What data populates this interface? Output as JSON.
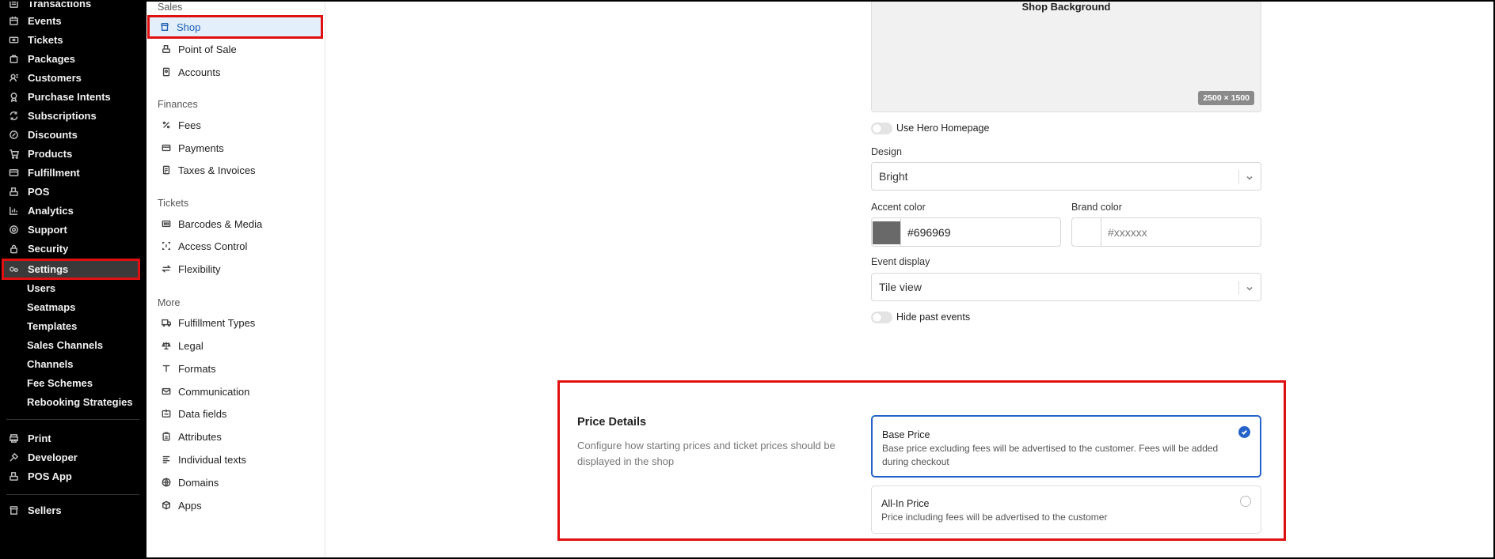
{
  "left_nav": {
    "items": [
      {
        "label": "Transactions",
        "icon": "receipt-icon"
      },
      {
        "label": "Events",
        "icon": "calendar-icon"
      },
      {
        "label": "Tickets",
        "icon": "ticket-icon"
      },
      {
        "label": "Packages",
        "icon": "package-icon"
      },
      {
        "label": "Customers",
        "icon": "customers-icon"
      },
      {
        "label": "Purchase Intents",
        "icon": "intent-icon"
      },
      {
        "label": "Subscriptions",
        "icon": "refresh-icon"
      },
      {
        "label": "Discounts",
        "icon": "discount-icon"
      },
      {
        "label": "Products",
        "icon": "cart-icon"
      },
      {
        "label": "Fulfillment",
        "icon": "truck-icon"
      },
      {
        "label": "POS",
        "icon": "register-icon"
      },
      {
        "label": "Analytics",
        "icon": "chart-icon"
      },
      {
        "label": "Support",
        "icon": "support-icon"
      },
      {
        "label": "Security",
        "icon": "lock-icon"
      },
      {
        "label": "Settings",
        "icon": "settings-icon"
      }
    ],
    "settings_sub": [
      "Users",
      "Seatmaps",
      "Templates",
      "Sales Channels",
      "Channels",
      "Fee Schemes",
      "Rebooking Strategies"
    ],
    "bottom_items": [
      {
        "label": "Print",
        "icon": "print-icon"
      },
      {
        "label": "Developer",
        "icon": "developer-icon"
      },
      {
        "label": "POS App",
        "icon": "register-icon"
      }
    ],
    "sellers": {
      "label": "Sellers",
      "icon": "store-icon"
    }
  },
  "sub_nav": {
    "groups": {
      "sales": "Sales",
      "finances": "Finances",
      "tickets": "Tickets",
      "more": "More"
    },
    "sales_items": [
      {
        "label": "Shop",
        "icon": "store-icon"
      },
      {
        "label": "Point of Sale",
        "icon": "register-icon"
      },
      {
        "label": "Accounts",
        "icon": "accounts-icon"
      }
    ],
    "finance_items": [
      {
        "label": "Fees",
        "icon": "percent-icon"
      },
      {
        "label": "Payments",
        "icon": "card-icon"
      },
      {
        "label": "Taxes & Invoices",
        "icon": "invoice-icon"
      }
    ],
    "ticket_items": [
      {
        "label": "Barcodes & Media",
        "icon": "barcode-icon"
      },
      {
        "label": "Access Control",
        "icon": "scan-icon"
      },
      {
        "label": "Flexibility",
        "icon": "swap-icon"
      }
    ],
    "more_items": [
      {
        "label": "Fulfillment Types",
        "icon": "truck-icon"
      },
      {
        "label": "Legal",
        "icon": "scale-icon"
      },
      {
        "label": "Formats",
        "icon": "text-icon"
      },
      {
        "label": "Communication",
        "icon": "mail-icon"
      },
      {
        "label": "Data fields",
        "icon": "datafield-icon"
      },
      {
        "label": "Attributes",
        "icon": "clipboard-icon"
      },
      {
        "label": "Individual texts",
        "icon": "lines-icon"
      },
      {
        "label": "Domains",
        "icon": "globe-icon"
      },
      {
        "label": "Apps",
        "icon": "box-icon"
      }
    ]
  },
  "shop_settings": {
    "background_title": "Shop Background",
    "background_size": "2500 × 1500",
    "hero_toggle_label": "Use Hero Homepage",
    "design_label": "Design",
    "design_value": "Bright",
    "accent_label": "Accent color",
    "accent_value": "#696969",
    "accent_swatch": "#696969",
    "brand_label": "Brand color",
    "brand_placeholder": "#xxxxxx",
    "event_display_label": "Event display",
    "event_display_value": "Tile view",
    "hide_past_label": "Hide past events"
  },
  "price_details": {
    "title": "Price Details",
    "description": "Configure how starting prices and ticket prices should be displayed in the shop",
    "options": [
      {
        "title": "Base Price",
        "description": "Base price excluding fees will be advertised to the customer. Fees will be added during checkout",
        "selected": true
      },
      {
        "title": "All-In Price",
        "description": "Price including fees will be advertised to the customer",
        "selected": false
      }
    ]
  },
  "colors": {
    "highlight": "#e01010",
    "selected_accent": "#2563c9",
    "active_nav_bg": "#e3effb"
  }
}
